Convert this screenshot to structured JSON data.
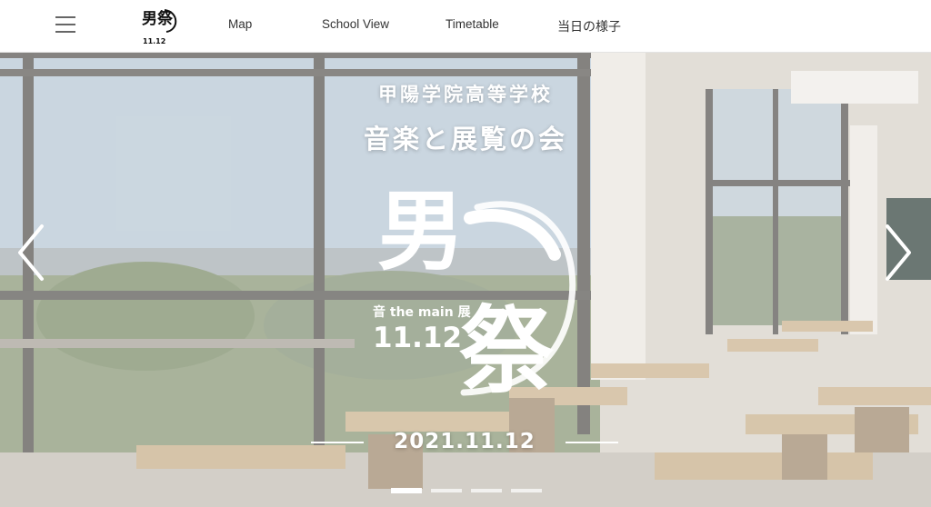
{
  "header": {
    "menu_icon": "hamburger-menu-icon",
    "logo": {
      "main": "男祭",
      "date": "11.12"
    },
    "nav": [
      {
        "label": "Map"
      },
      {
        "label": "School View"
      },
      {
        "label": "Timetable"
      },
      {
        "label": "当日の様子"
      }
    ]
  },
  "hero": {
    "school_name": "甲陽学院高等学校",
    "event_name": "音楽と展覧の会",
    "emblem": {
      "char1": "男",
      "char2": "祭",
      "subtitle": "音 the main 展",
      "date": "11.12"
    },
    "date": "2021.11.12",
    "prev_icon": "chevron-left-icon",
    "next_icon": "chevron-right-icon",
    "slides": 4,
    "active_slide": 1
  },
  "colors": {
    "header_bg": "#ffffff",
    "nav_text": "#333333",
    "hero_text": "#ffffff"
  }
}
